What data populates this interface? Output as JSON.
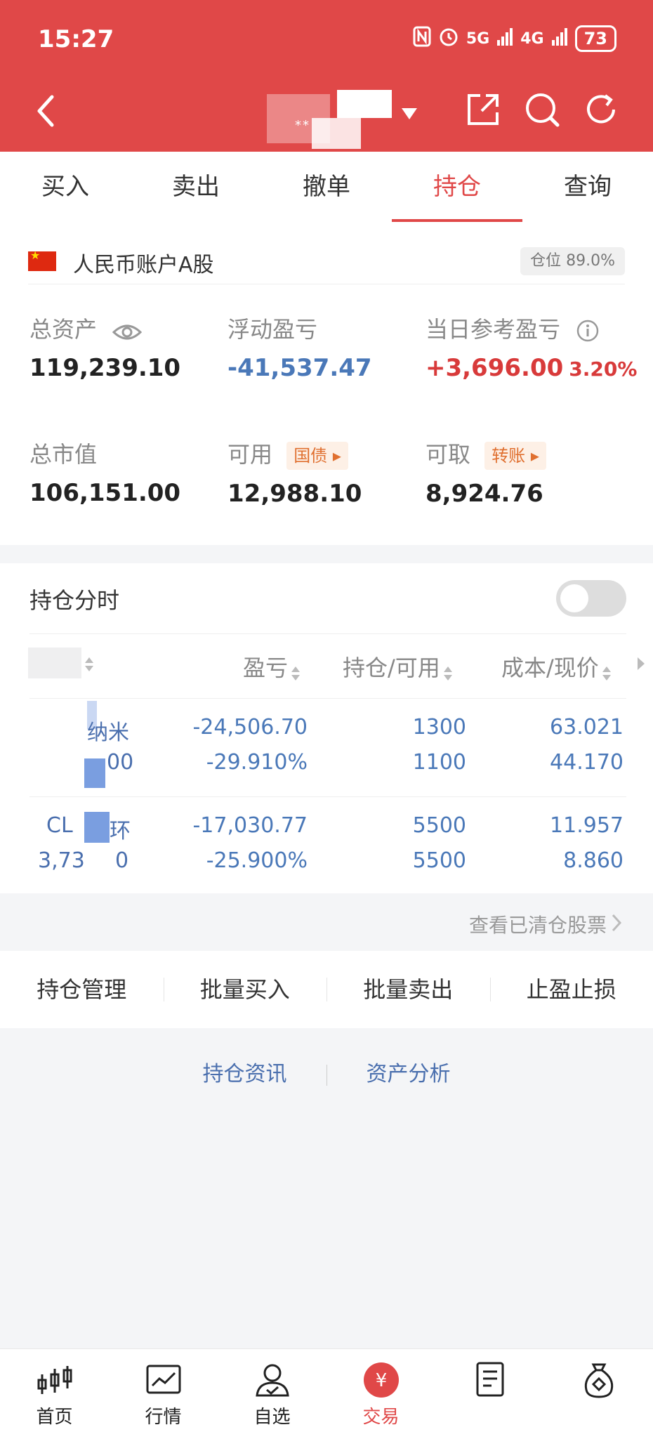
{
  "status_bar": {
    "time": "15:27",
    "battery": "73",
    "signals": [
      "5G",
      "4G"
    ]
  },
  "header": {
    "account_masked": "**"
  },
  "tabs": [
    {
      "label": "买入"
    },
    {
      "label": "卖出"
    },
    {
      "label": "撤单"
    },
    {
      "label": "持仓",
      "active": true
    },
    {
      "label": "查询"
    }
  ],
  "account": {
    "label": "人民币账户A股",
    "position_badge": "仓位 89.0%",
    "total_assets_label": "总资产",
    "total_assets": "119,239.10",
    "floating_pl_label": "浮动盈亏",
    "floating_pl": "-41,537.47",
    "daily_pl_label": "当日参考盈亏",
    "daily_pl": "+3,696.00",
    "daily_pl_pct": "3.20%",
    "market_value_label": "总市值",
    "market_value": "106,151.00",
    "available_label": "可用",
    "available": "12,988.10",
    "available_tag": "国债",
    "withdrawable_label": "可取",
    "withdrawable": "8,924.76",
    "withdrawable_tag": "转账"
  },
  "holdings": {
    "title": "持仓分时",
    "columns": [
      "盈亏",
      "持仓/可用",
      "成本/现价"
    ],
    "rows": [
      {
        "name": "纳米",
        "sub": "00",
        "pl": "-24,506.70",
        "pl_pct": "-29.910%",
        "hold": "1300",
        "avail": "1100",
        "cost": "63.021",
        "price": "44.170"
      },
      {
        "name_prefix": "CL",
        "name": "环",
        "sub_prefix": "3,73",
        "sub": "0",
        "pl": "-17,030.77",
        "pl_pct": "-25.900%",
        "hold": "5500",
        "avail": "5500",
        "cost": "11.957",
        "price": "8.860"
      }
    ],
    "cleared_link": "查看已清仓股票"
  },
  "actions": [
    "持仓管理",
    "批量买入",
    "批量卖出",
    "止盈止损"
  ],
  "links": [
    "持仓资讯",
    "资产分析"
  ],
  "bottom_nav": [
    {
      "label": "首页",
      "icon": "candlestick-icon"
    },
    {
      "label": "行情",
      "icon": "chart-icon"
    },
    {
      "label": "自选",
      "icon": "user-check-icon"
    },
    {
      "label": "交易",
      "icon": "yuan-icon",
      "active": true
    },
    {
      "label": "",
      "icon": "document-icon"
    },
    {
      "label": "",
      "icon": "money-bag-icon"
    }
  ],
  "colors": {
    "brand": "#e04848",
    "loss": "#4a78b8",
    "gain": "#d83a3a"
  }
}
